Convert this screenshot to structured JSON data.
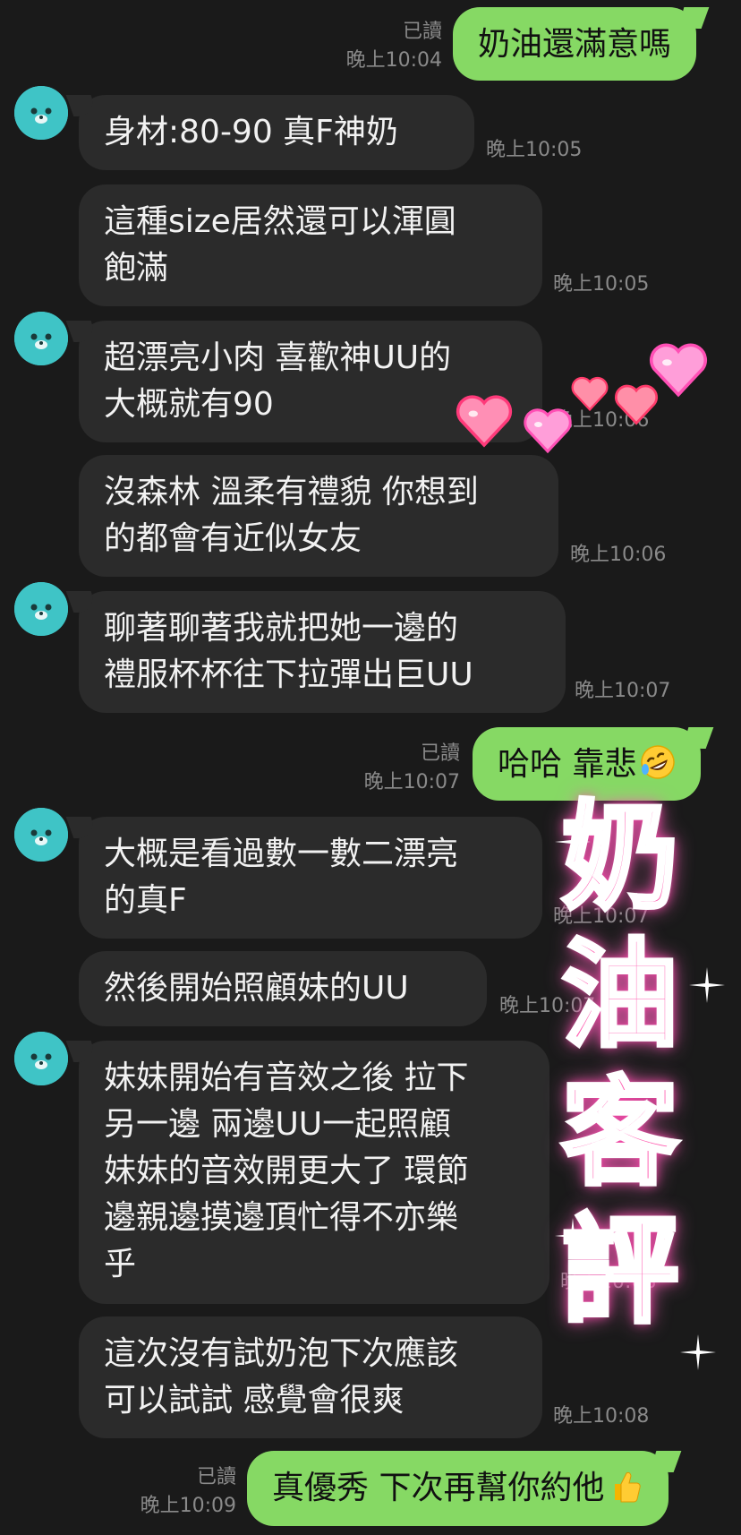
{
  "messages": [
    {
      "dir": "out",
      "text": "奶油還滿意嗎",
      "read": "已讀",
      "time": "晚上10:04"
    },
    {
      "dir": "in",
      "text": "身材:80-90 真F神奶",
      "time": "晚上10:05"
    },
    {
      "dir": "in",
      "text": "這種size居然還可以渾圓\n飽滿",
      "time": "晚上10:05"
    },
    {
      "dir": "in",
      "text": "超漂亮小肉 喜歡神UU的\n大概就有90",
      "time": "晚上10:06"
    },
    {
      "dir": "in",
      "text": "沒森林 溫柔有禮貌 你想到\n的都會有近似女友",
      "time": "晚上10:06"
    },
    {
      "dir": "in",
      "text": "聊著聊著我就把她一邊的\n禮服杯杯往下拉彈出巨UU",
      "time": "晚上10:07"
    },
    {
      "dir": "out",
      "text": "哈哈 靠悲",
      "read": "已讀",
      "time": "晚上10:07",
      "emoji": "rofl"
    },
    {
      "dir": "in",
      "text": "大概是看過數一數二漂亮\n的真F",
      "time": "晚上10:07"
    },
    {
      "dir": "in",
      "text": "然後開始照顧妹的UU",
      "time": "晚上10:07"
    },
    {
      "dir": "in",
      "text": "妹妹開始有音效之後 拉下\n另一邊 兩邊UU一起照顧\n妹妹的音效開更大了 環節\n邊親邊摸邊頂忙得不亦樂\n乎",
      "time": "晚上10:08"
    },
    {
      "dir": "in",
      "text": "這次沒有試奶泡下次應該\n可以試試 感覺會很爽",
      "time": "晚上10:08"
    },
    {
      "dir": "out",
      "text": "真優秀 下次再幫你約他",
      "read": "已讀",
      "time": "晚上10:09",
      "emoji": "thumbs-up"
    }
  ],
  "sticker": {
    "text": "奶\n油\n客\n評"
  },
  "colors": {
    "background": "#1a1a1a",
    "incoming_bubble": "#2b2b2b",
    "outgoing_bubble": "#86d964",
    "avatar": "#3fc4c6",
    "meta_text": "#8a8a8a",
    "sticker_pink": "#ff5db0"
  }
}
